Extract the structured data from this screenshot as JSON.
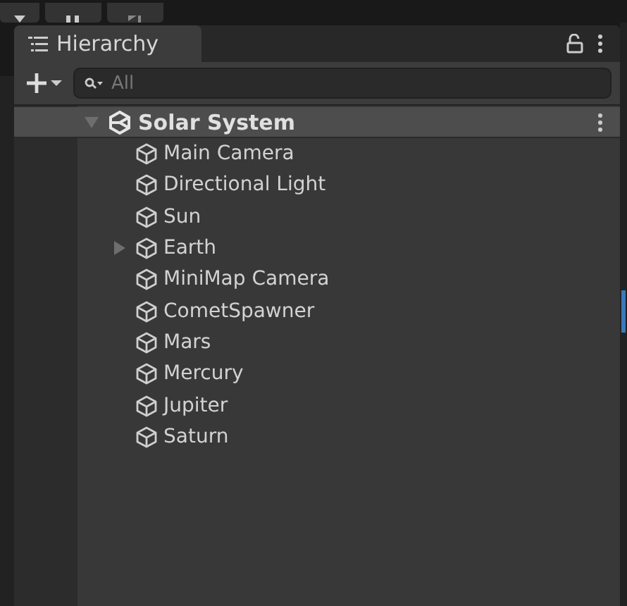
{
  "panel": {
    "title": "Hierarchy"
  },
  "search": {
    "placeholder": "All"
  },
  "scene": {
    "name": "Solar System",
    "expanded": true
  },
  "items": [
    {
      "name": "Main Camera",
      "expandable": false
    },
    {
      "name": "Directional Light",
      "expandable": false
    },
    {
      "name": "Sun",
      "expandable": false
    },
    {
      "name": "Earth",
      "expandable": true
    },
    {
      "name": "MiniMap Camera",
      "expandable": false
    },
    {
      "name": "CometSpawner",
      "expandable": false
    },
    {
      "name": "Mars",
      "expandable": false
    },
    {
      "name": "Mercury",
      "expandable": false
    },
    {
      "name": "Jupiter",
      "expandable": false
    },
    {
      "name": "Saturn",
      "expandable": false
    }
  ]
}
